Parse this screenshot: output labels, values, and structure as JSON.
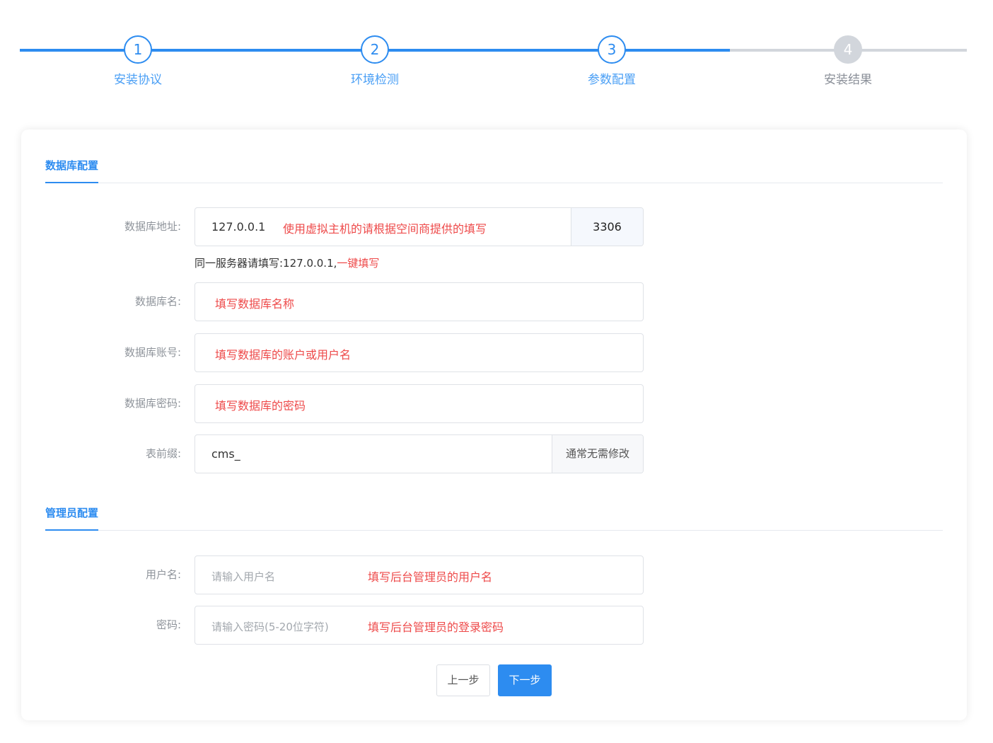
{
  "steps": [
    {
      "number": "1",
      "label": "安装协议",
      "state": "done"
    },
    {
      "number": "2",
      "label": "环境检测",
      "state": "done"
    },
    {
      "number": "3",
      "label": "参数配置",
      "state": "active"
    },
    {
      "number": "4",
      "label": "安装结果",
      "state": "pending"
    }
  ],
  "database_section": {
    "title": "数据库配置",
    "host": {
      "label": "数据库地址:",
      "value": "127.0.0.1",
      "hint": "使用虚拟主机的请根据空间商提供的填写",
      "port": "3306"
    },
    "host_helper": {
      "text": "同一服务器请填写:127.0.0.1,",
      "link": "一键填写"
    },
    "name": {
      "label": "数据库名:",
      "hint": "填写数据库名称"
    },
    "user": {
      "label": "数据库账号:",
      "hint": "填写数据库的账户或用户名"
    },
    "password": {
      "label": "数据库密码:",
      "hint": "填写数据库的密码"
    },
    "prefix": {
      "label": "表前缀:",
      "value": "cms_",
      "addon": "通常无需修改"
    }
  },
  "admin_section": {
    "title": "管理员配置",
    "username": {
      "label": "用户名:",
      "placeholder": "请输入用户名",
      "hint": "填写后台管理员的用户名"
    },
    "password": {
      "label": "密码:",
      "placeholder": "请输入密码(5-20位字符)",
      "hint": "填写后台管理员的登录密码"
    }
  },
  "buttons": {
    "prev": "上一步",
    "next": "下一步"
  },
  "colors": {
    "accent": "#2d8cf0",
    "hint_red": "#ee4a4a",
    "pending_gray": "#d2d6dc"
  }
}
